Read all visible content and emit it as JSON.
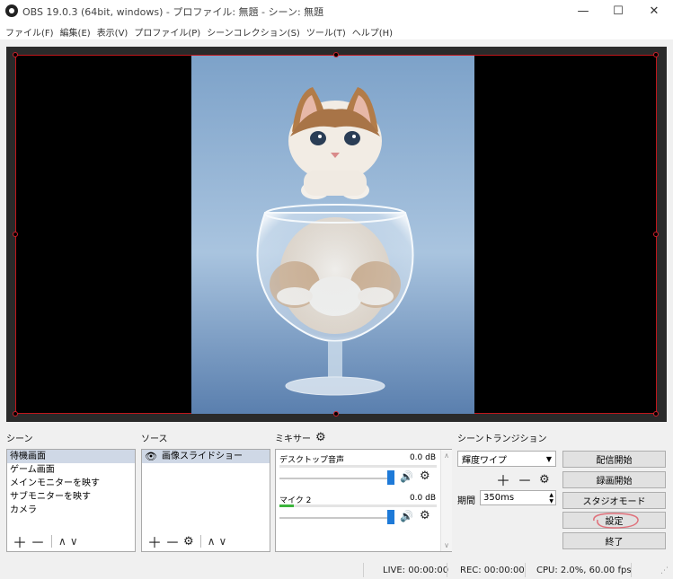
{
  "window": {
    "title": "OBS 19.0.3 (64bit, windows) - プロファイル: 無題 - シーン: 無題",
    "minimize_glyph": "—",
    "maximize_glyph": "☐",
    "close_glyph": "✕"
  },
  "menu": [
    "ファイル(F)",
    "編集(E)",
    "表示(V)",
    "プロファイル(P)",
    "シーンコレクション(S)",
    "ツール(T)",
    "ヘルプ(H)"
  ],
  "scenes": {
    "title": "シーン",
    "items": [
      "待機画面",
      "ゲーム画面",
      "メインモニターを映す",
      "サブモニターを映す",
      "カメラ"
    ],
    "selected_index": 0
  },
  "sources": {
    "title": "ソース",
    "items": [
      {
        "label": "画像スライドショー",
        "icon": "eye-icon"
      }
    ]
  },
  "mixer": {
    "title": "ミキサー",
    "tracks": [
      {
        "name": "デスクトップ音声",
        "db": "0.0 dB",
        "level": 0.0,
        "volume": 1.0
      },
      {
        "name": "マイク 2",
        "db": "0.0 dB",
        "level": 0.09,
        "volume": 1.0
      }
    ]
  },
  "transitions": {
    "title": "シーントランジション",
    "selected": "輝度ワイプ",
    "duration_label": "期間",
    "duration_value": "350ms"
  },
  "controls": {
    "start_streaming": "配信開始",
    "start_recording": "録画開始",
    "studio_mode": "スタジオモード",
    "settings": "設定",
    "exit": "終了"
  },
  "status": {
    "live": "LIVE: 00:00:00",
    "rec": "REC: 00:00:00",
    "cpu": "CPU: 2.0%, 60.00 fps"
  },
  "colors": {
    "selection_border": "#c0161b",
    "slider_blue": "#1e7ad8",
    "meter_green": "#3cb43c",
    "annotation_circle": "#e0707a"
  }
}
